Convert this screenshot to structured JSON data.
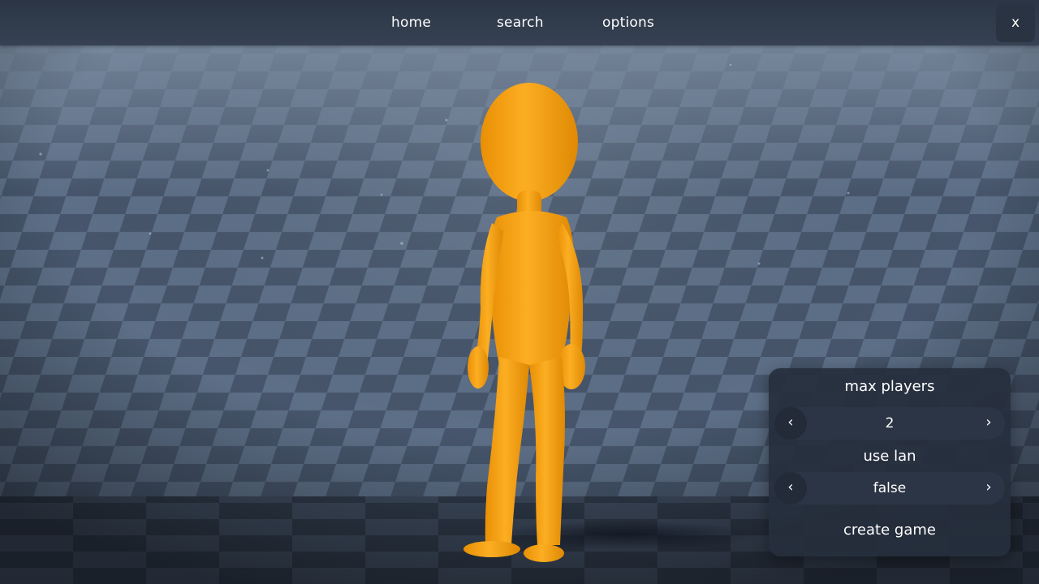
{
  "nav": {
    "home": "home",
    "search": "search",
    "options": "options",
    "close": "x"
  },
  "panel": {
    "max_players": {
      "label": "max players",
      "value": "2",
      "prev_icon": "‹",
      "next_icon": "›"
    },
    "use_lan": {
      "label": "use lan",
      "value": "false",
      "prev_icon": "‹",
      "next_icon": "›"
    },
    "create_label": "create game"
  },
  "icons": {
    "prev": "chevron-left-icon",
    "next": "chevron-right-icon",
    "close": "close-icon"
  },
  "colors": {
    "character": "#f5a00f",
    "topbar": "#323d4e",
    "panel": "#262e3c",
    "floor_light": "#5f7189",
    "floor_dark": "#3f4c60"
  }
}
